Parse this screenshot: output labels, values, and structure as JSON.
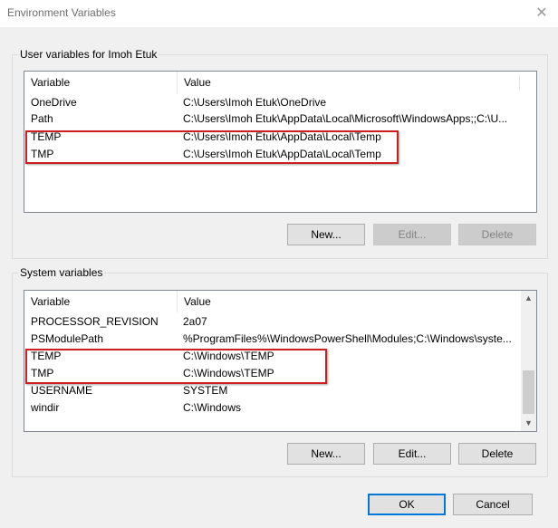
{
  "window": {
    "title": "Environment Variables",
    "close_glyph": "✕"
  },
  "user_section": {
    "label": "User variables for Imoh Etuk",
    "columns": [
      "Variable",
      "Value"
    ],
    "rows": [
      {
        "variable": "OneDrive",
        "value": "C:\\Users\\Imoh Etuk\\OneDrive"
      },
      {
        "variable": "Path",
        "value": "C:\\Users\\Imoh Etuk\\AppData\\Local\\Microsoft\\WindowsApps;;C:\\U..."
      },
      {
        "variable": "TEMP",
        "value": "C:\\Users\\Imoh Etuk\\AppData\\Local\\Temp"
      },
      {
        "variable": "TMP",
        "value": "C:\\Users\\Imoh Etuk\\AppData\\Local\\Temp"
      }
    ],
    "buttons": {
      "new": "New...",
      "edit": "Edit...",
      "delete": "Delete"
    }
  },
  "system_section": {
    "label": "System variables",
    "columns": [
      "Variable",
      "Value"
    ],
    "rows": [
      {
        "variable": "PROCESSOR_REVISION",
        "value": "2a07"
      },
      {
        "variable": "PSModulePath",
        "value": "%ProgramFiles%\\WindowsPowerShell\\Modules;C:\\Windows\\syste..."
      },
      {
        "variable": "TEMP",
        "value": "C:\\Windows\\TEMP"
      },
      {
        "variable": "TMP",
        "value": "C:\\Windows\\TEMP"
      },
      {
        "variable": "USERNAME",
        "value": "SYSTEM"
      },
      {
        "variable": "windir",
        "value": "C:\\Windows"
      }
    ],
    "buttons": {
      "new": "New...",
      "edit": "Edit...",
      "delete": "Delete"
    }
  },
  "footer": {
    "ok": "OK",
    "cancel": "Cancel"
  },
  "colors": {
    "highlight_border": "#cc1f1f",
    "default_button_border": "#0078d7"
  }
}
